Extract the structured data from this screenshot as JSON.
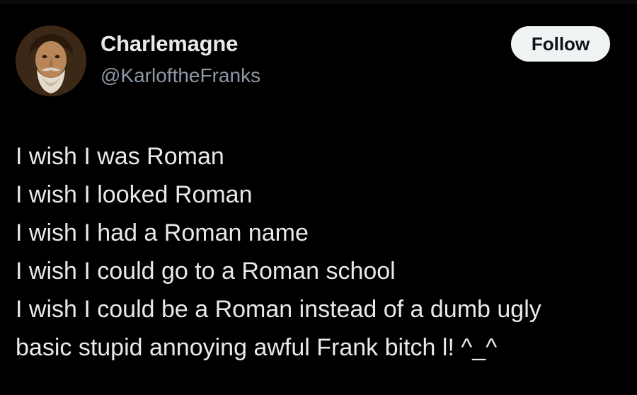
{
  "colors": {
    "background": "#000000",
    "text_primary": "#e7e9ea",
    "text_secondary": "#8b98a5",
    "follow_button_bg": "#eff3f4",
    "follow_button_text": "#0f1419"
  },
  "author": {
    "avatar_icon": "portrait-avatar-icon",
    "display_name": "Charlemagne",
    "handle": "@KarloftheFranks"
  },
  "actions": {
    "follow_label": "Follow"
  },
  "tweet": {
    "lines": [
      "I wish I was Roman",
      "I wish I looked Roman",
      "I wish I had a Roman name",
      "I wish I could go to a Roman school",
      "I wish I could be a Roman instead of a dumb ugly",
      "basic stupid annoying awful Frank bitch l! ^_^"
    ]
  }
}
